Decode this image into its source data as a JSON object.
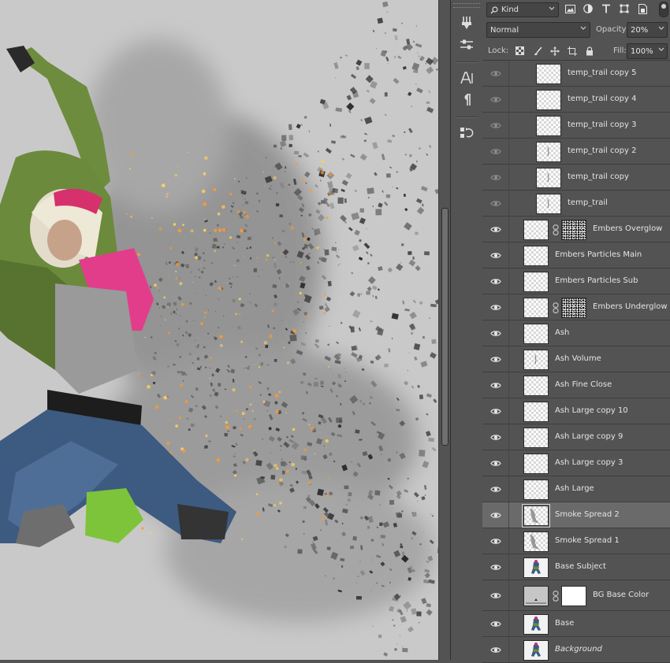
{
  "panel": {
    "kind_filter": {
      "label": "Kind",
      "icons": [
        "image-filter-icon",
        "adjustment-filter-icon",
        "type-filter-icon",
        "shape-filter-icon",
        "smart-object-filter-icon"
      ]
    },
    "blend_mode": "Normal",
    "opacity_label": "Opacity:",
    "opacity_value": "20%",
    "lock_label": "Lock:",
    "lock_icons": [
      "lock-transparent-icon",
      "lock-image-icon",
      "lock-position-icon",
      "lock-artboard-icon",
      "lock-all-icon"
    ],
    "fill_label": "Fill:",
    "fill_value": "100%"
  },
  "layers": [
    {
      "name": "temp_trail copy 5",
      "visible": false,
      "indent": true,
      "thumb": "checker"
    },
    {
      "name": "temp_trail copy 4",
      "visible": false,
      "indent": true,
      "thumb": "checker"
    },
    {
      "name": "temp_trail copy 3",
      "visible": false,
      "indent": true,
      "thumb": "checker"
    },
    {
      "name": "temp_trail copy 2",
      "visible": false,
      "indent": true,
      "thumb": "checker-mark"
    },
    {
      "name": "temp_trail copy",
      "visible": false,
      "indent": true,
      "thumb": "checker-mark"
    },
    {
      "name": "temp_trail",
      "visible": false,
      "indent": true,
      "thumb": "checker-mark"
    },
    {
      "name": "Embers Overglow",
      "visible": true,
      "mask": "noise",
      "thumb": "checker"
    },
    {
      "name": "Embers Particles Main",
      "visible": true,
      "thumb": "checker"
    },
    {
      "name": "Embers Particles Sub",
      "visible": true,
      "thumb": "checker"
    },
    {
      "name": "Embers Underglow",
      "visible": true,
      "mask": "noise",
      "thumb": "checker"
    },
    {
      "name": "Ash",
      "visible": true,
      "thumb": "checker"
    },
    {
      "name": "Ash Volume",
      "visible": true,
      "thumb": "checker-mark"
    },
    {
      "name": "Ash Fine Close",
      "visible": true,
      "thumb": "checker"
    },
    {
      "name": "Ash Large copy 10",
      "visible": true,
      "thumb": "checker"
    },
    {
      "name": "Ash Large copy 9",
      "visible": true,
      "thumb": "checker"
    },
    {
      "name": "Ash Large copy 3",
      "visible": true,
      "thumb": "checker"
    },
    {
      "name": "Ash Large",
      "visible": true,
      "thumb": "checker"
    },
    {
      "name": "Smoke Spread 2",
      "visible": true,
      "selected": true,
      "thumb": "checker-smoke"
    },
    {
      "name": "Smoke Spread 1",
      "visible": true,
      "thumb": "checker-smoke"
    },
    {
      "name": "Base Subject",
      "visible": true,
      "thumb": "figure"
    },
    {
      "name": "BG Base Color",
      "visible": true,
      "mask": "white",
      "thumb": "grey"
    },
    {
      "name": "Base",
      "visible": true,
      "thumb": "figure"
    },
    {
      "name": "Background",
      "visible": true,
      "italic": true,
      "thumb": "figure"
    }
  ],
  "tools": [
    "brush-presets-icon",
    "adjust-sliders-icon",
    "character-icon",
    "paragraph-icon",
    "history-icon"
  ]
}
